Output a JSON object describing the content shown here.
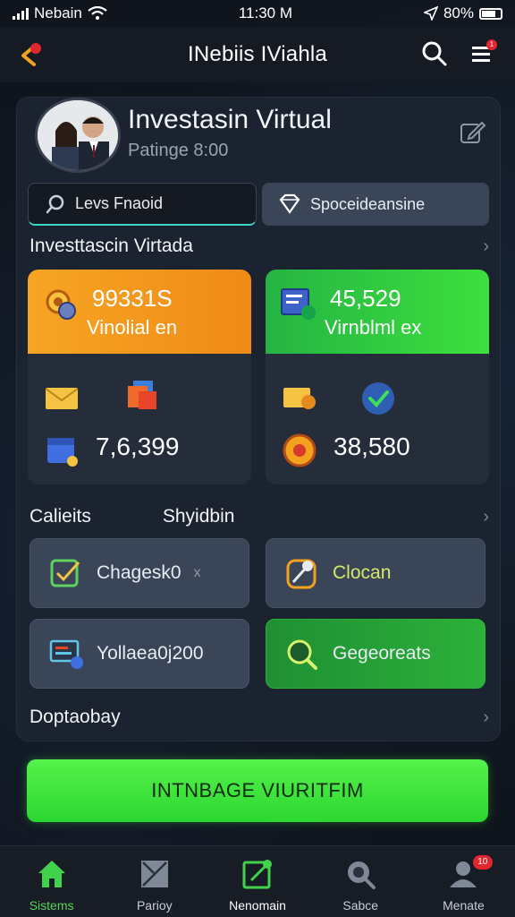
{
  "status_bar": {
    "carrier": "Nebain",
    "time": "11:30 M",
    "battery": "80%"
  },
  "header": {
    "title": "INebiis IViahla",
    "menu_badge": "1"
  },
  "profile": {
    "name": "Investasin Virtual",
    "subtitle": "Patinge 8:00"
  },
  "tabs": [
    {
      "label": "Levs Fnaoid",
      "active": true
    },
    {
      "label": "Spoceideansine",
      "active": false
    }
  ],
  "sections": {
    "investments_title": "Investtascin Virtada",
    "calendar_title": "Calieits",
    "shortcuts_title": "Shyidbin",
    "display_title": "Doptaobay"
  },
  "stats": [
    {
      "value": "99331S",
      "label": "Vinolial en",
      "bottom_value": "7,6,399",
      "color": "#f6a523"
    },
    {
      "value": "45,529",
      "label": "Virnblml ex",
      "bottom_value": "38,580",
      "color": "#2fc83f"
    }
  ],
  "actions": [
    {
      "label": "Chagesk0",
      "suffix": "x",
      "style": "dark"
    },
    {
      "label": "Clocan",
      "suffix": "",
      "style": "dark"
    },
    {
      "label": "Yollaea0j200",
      "suffix": "",
      "style": "dark"
    },
    {
      "label": "Gegeoreats",
      "suffix": "",
      "style": "green"
    }
  ],
  "cta": {
    "label": "INTNBAGE VIURITFIM"
  },
  "bottom_nav": [
    {
      "label": "Sistems",
      "icon": "home-icon",
      "active": true
    },
    {
      "label": "Parioy",
      "icon": "portfolio-icon",
      "active": false
    },
    {
      "label": "Nenomain",
      "icon": "edit-chart-icon",
      "active": false
    },
    {
      "label": "Sabce",
      "icon": "search-icon",
      "active": false
    },
    {
      "label": "Menate",
      "icon": "user-icon",
      "active": false,
      "badge": "10"
    }
  ],
  "colors": {
    "accent_green": "#3de03d",
    "accent_orange": "#f6a523",
    "badge_red": "#e0262f",
    "background": "#10151d"
  }
}
